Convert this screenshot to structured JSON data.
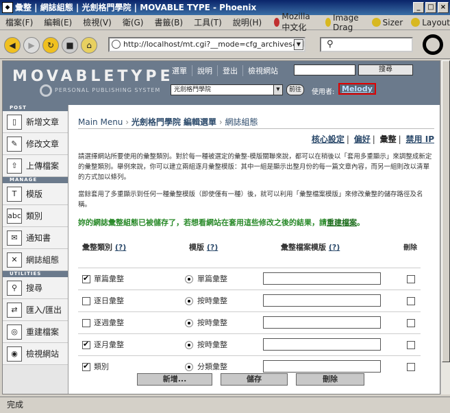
{
  "window": {
    "title": "彙整 | 網誌組態 | 光劍格門學院 | MOVABLE TYPE - Phoenix",
    "app_icon": "phoenix-icon",
    "buttons": [
      "_",
      "□",
      "×"
    ]
  },
  "menu": [
    "檔案(F)",
    "編輯(E)",
    "檢視(V)",
    "衛(G)",
    "書籤(B)",
    "工具(T)",
    "說明(H)"
  ],
  "extensions": [
    {
      "label": "Mozilla 中文化",
      "color": "#c03030"
    },
    {
      "label": "Image Drag",
      "color": "#d8b820"
    },
    {
      "label": "Sizer",
      "color": "#d8b820"
    },
    {
      "label": "Layout",
      "color": "#d8b820"
    }
  ],
  "address": {
    "url": "http://localhost/mt.cgi?__mode=cfg_archives&blog_id"
  },
  "mt": {
    "logo": "MOVABLETYPE",
    "logo_sub": "PERSONAL PUBLISHING SYSTEM",
    "nav": [
      "選單",
      "說明",
      "登出",
      "檢視網站"
    ],
    "search_button": "搜尋",
    "blog_select": "光劍格門學院",
    "go_button": "前往",
    "user_label": "使用者:",
    "user_name": "Melody"
  },
  "sidebar": {
    "sections": [
      {
        "title": "POST",
        "items": [
          {
            "label": "新增文章",
            "icon": "new-entry-icon"
          },
          {
            "label": "修改文章",
            "icon": "edit-entry-icon"
          },
          {
            "label": "上傳檔案",
            "icon": "upload-icon"
          }
        ]
      },
      {
        "title": "MANAGE",
        "items": [
          {
            "label": "模版",
            "icon": "template-icon"
          },
          {
            "label": "類別",
            "icon": "category-icon"
          },
          {
            "label": "通知書",
            "icon": "notification-icon"
          },
          {
            "label": "網誌組態",
            "icon": "config-icon"
          }
        ]
      },
      {
        "title": "UTILITIES",
        "items": [
          {
            "label": "搜尋",
            "icon": "search-icon"
          },
          {
            "label": "匯入/匯出",
            "icon": "import-export-icon"
          },
          {
            "label": "重建檔案",
            "icon": "rebuild-icon"
          },
          {
            "label": "檢視網站",
            "icon": "view-site-icon"
          }
        ]
      }
    ]
  },
  "breadcrumb": {
    "main": "Main Menu",
    "blog": "光劍格門學院 編輯選單",
    "current": "網誌組態"
  },
  "subtabs": {
    "core": "核心設定",
    "prefs": "偏好",
    "archives": "彙整",
    "banlist": "禁用 IP"
  },
  "description": {
    "p1": "請選擇網站所要使用的彙整類別。對於每一種被選定的彙整-模版關聯來說，都可以在稍後以「套用多重顯示」來調整成新定的彙整類別。舉例來說，你可以建立兩組逐月彙整模版：其中一組是顯示出整月份的每一篇文章內容，而另一組則改以清單的方式加以條列。",
    "p2": "當餘套用了多重顯示到任何一種彙整模版（即使僅有一種）後，就可以利用「彙整檔案模版」來修改彙整的儲存路徑及名稱。"
  },
  "message": {
    "text": "妳的網誌彙整組態已被儲存了，若想看網站在套用這些修改之後的結果，請",
    "link": "重建檔案",
    "end": "。"
  },
  "table": {
    "headers": {
      "type": "彙整類別",
      "template": "模版",
      "file": "彙整檔案模版",
      "delete": "刪除",
      "help": "(?)"
    },
    "rows": [
      {
        "checked": true,
        "type": "單篇彙整",
        "template": "單篇彙整"
      },
      {
        "checked": false,
        "type": "逐日彙整",
        "template": "按時彙整"
      },
      {
        "checked": false,
        "type": "逐週彙整",
        "template": "按時彙整"
      },
      {
        "checked": true,
        "type": "逐月彙整",
        "template": "按時彙整"
      },
      {
        "checked": true,
        "type": "類別",
        "template": "分類彙整"
      }
    ]
  },
  "buttons": {
    "add": "新增...",
    "save": "儲存",
    "delete": "刪除"
  },
  "status": "完成"
}
